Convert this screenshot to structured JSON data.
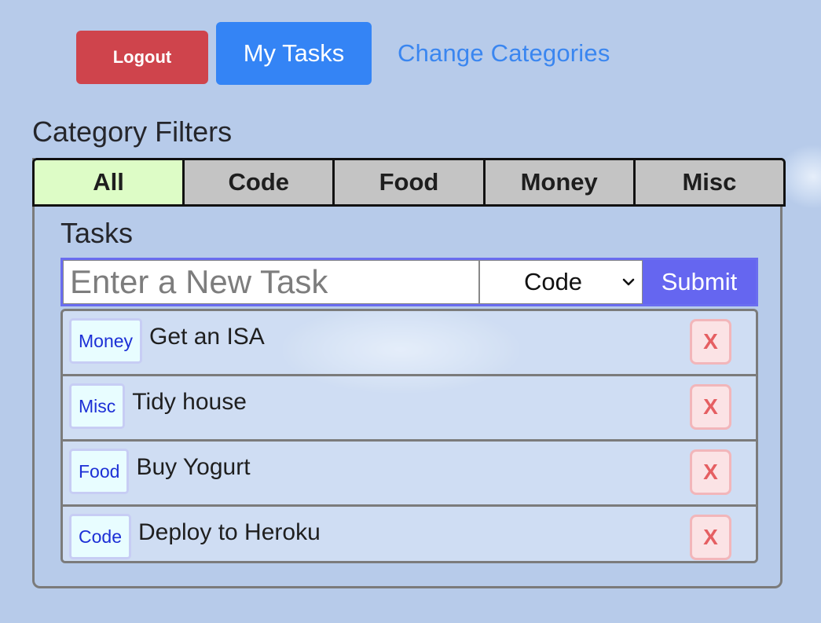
{
  "nav": {
    "logout_label": "Logout",
    "my_tasks_label": "My Tasks",
    "change_categories_label": "Change Categories"
  },
  "filters": {
    "title": "Category Filters",
    "tabs": [
      {
        "label": "All",
        "active": true
      },
      {
        "label": "Code",
        "active": false
      },
      {
        "label": "Food",
        "active": false
      },
      {
        "label": "Money",
        "active": false
      },
      {
        "label": "Misc",
        "active": false
      }
    ]
  },
  "tasks": {
    "title": "Tasks",
    "form": {
      "input_value": "",
      "input_placeholder": "Enter a New Task",
      "category_selected": "Code",
      "submit_label": "Submit"
    },
    "items": [
      {
        "category": "Money",
        "text": "Get an ISA",
        "delete_label": "X"
      },
      {
        "category": "Misc",
        "text": "Tidy house",
        "delete_label": "X"
      },
      {
        "category": "Food",
        "text": "Buy Yogurt",
        "delete_label": "X"
      },
      {
        "category": "Code",
        "text": "Deploy to Heroku",
        "delete_label": "X"
      }
    ]
  },
  "colors": {
    "background": "#b7cbea",
    "logout": "#cf444c",
    "primary": "#3484f5",
    "link": "#3a86f0",
    "submit": "#6566f0",
    "active_tab": "#ddfcc6",
    "inactive_tab": "#c4c4c4",
    "badge_text": "#1c2fd6",
    "delete_text": "#e55f62"
  }
}
